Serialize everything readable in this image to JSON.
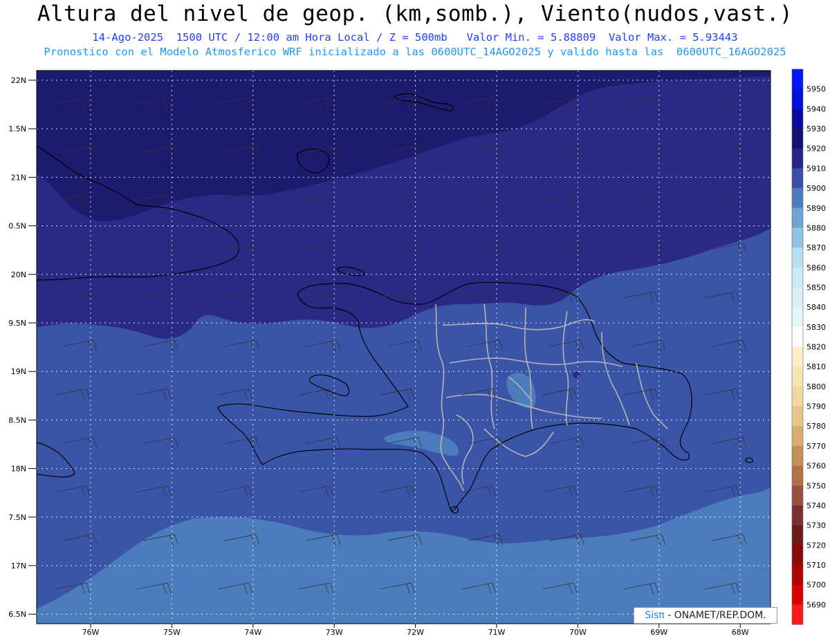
{
  "header": {
    "title": "Altura del nivel de geop. (km,somb.), Viento(nudos,vast.)",
    "subtitle1": "14-Ago-2025  1500 UTC / 12:00 am Hora Local / Z = 500mb   Valor Min. = 5.88809  Valor Max. = 5.93443",
    "subtitle2": "Pronostico con el Modelo Atmosferico WRF inicializado a las 0600UTC_14AGO2025 y valido hasta las  0600UTC_16AGO2025"
  },
  "map": {
    "lat_labels": [
      "22N",
      "1.5N",
      "21N",
      "0.5N",
      "20N",
      "9.5N",
      "19N",
      "8.5N",
      "18N",
      "7.5N",
      "17N",
      "6.5N"
    ],
    "lon_labels": [
      "76W",
      "75W",
      "74W",
      "73W",
      "72W",
      "71W",
      "70W",
      "69W",
      "68W"
    ],
    "colors": {
      "c5930": "#1d1b6e",
      "c5920": "#2a2a86",
      "c5910": "#3a55a8",
      "c5900": "#4b7dbc",
      "c5890": "#5d93c8"
    }
  },
  "colorbar": {
    "levels": [
      "5950",
      "5940",
      "5930",
      "5920",
      "5910",
      "5900",
      "5890",
      "5880",
      "5870",
      "5860",
      "5850",
      "5840",
      "5830",
      "5820",
      "5810",
      "5800",
      "5790",
      "5780",
      "5770",
      "5760",
      "5750",
      "5740",
      "5730",
      "5720",
      "5710",
      "5700",
      "5690"
    ],
    "colors": [
      "#0016ff",
      "#0010d8",
      "#0a0aa0",
      "#12126e",
      "#26268a",
      "#3a4fa6",
      "#4f7cbc",
      "#6fa3d2",
      "#92c4e2",
      "#b7e0ef",
      "#cdeaf4",
      "#d8f0f7",
      "#e3f6fa",
      "#ffffff",
      "#fbf0c8",
      "#f6e4b4",
      "#f0d8a2",
      "#e6c48a",
      "#d9ad72",
      "#c5915a",
      "#b07148",
      "#96523e",
      "#7d3030",
      "#6c1a1a",
      "#8a0a0a",
      "#b00000",
      "#d80000",
      "#ff1a1a"
    ]
  },
  "credit": {
    "brand": "Sisπ",
    "org": "- ONAMET/REP.DOM."
  }
}
